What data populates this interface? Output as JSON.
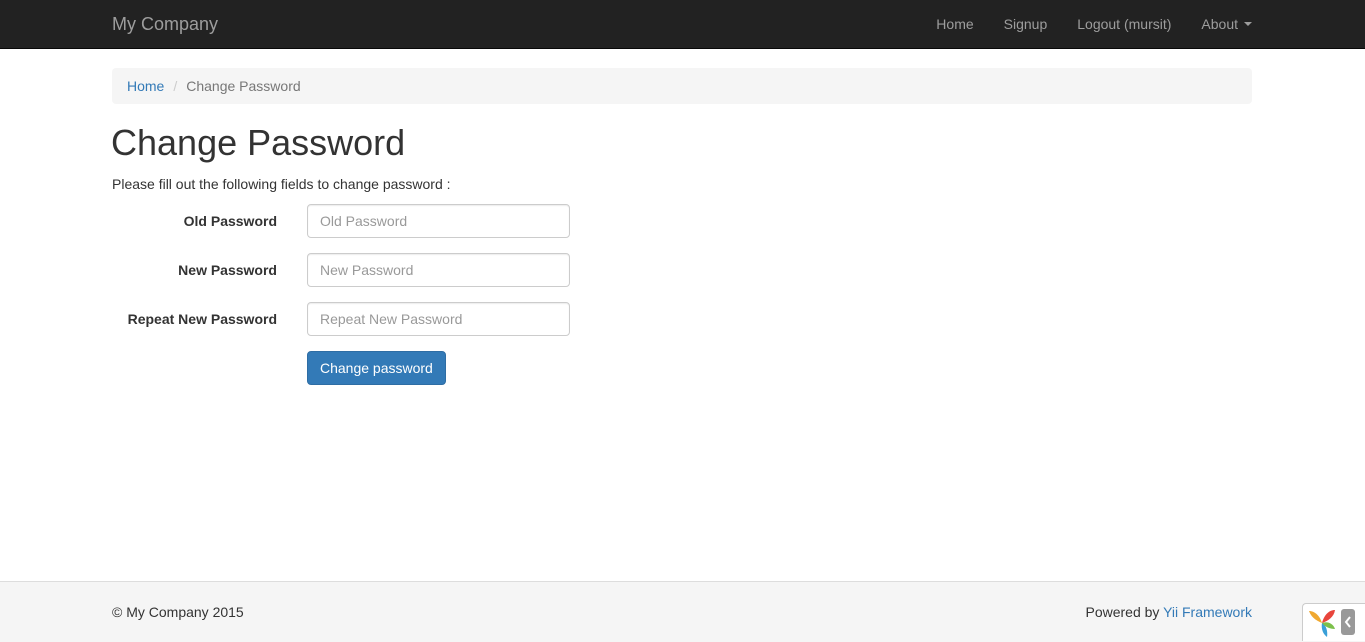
{
  "navbar": {
    "brand": "My Company",
    "items": [
      {
        "label": "Home"
      },
      {
        "label": "Signup"
      },
      {
        "label": "Logout (mursit)"
      },
      {
        "label": "About"
      }
    ]
  },
  "breadcrumb": {
    "home": "Home",
    "separator": "/",
    "active": "Change Password"
  },
  "page": {
    "title": "Change Password",
    "intro": "Please fill out the following fields to change password :"
  },
  "form": {
    "old_password": {
      "label": "Old Password",
      "placeholder": "Old Password",
      "value": ""
    },
    "new_password": {
      "label": "New Password",
      "placeholder": "New Password",
      "value": ""
    },
    "repeat_password": {
      "label": "Repeat New Password",
      "placeholder": "Repeat New Password",
      "value": ""
    },
    "submit_label": "Change password"
  },
  "footer": {
    "copyright": "© My Company 2015",
    "powered_by": "Powered by ",
    "framework_link": "Yii Framework"
  },
  "colors": {
    "navbar_bg": "#222222",
    "link": "#337ab7",
    "primary_button": "#337ab7"
  },
  "icons": {
    "debug_logo": "yii-logo-icon",
    "debug_toggle": "chevron-left-icon"
  }
}
